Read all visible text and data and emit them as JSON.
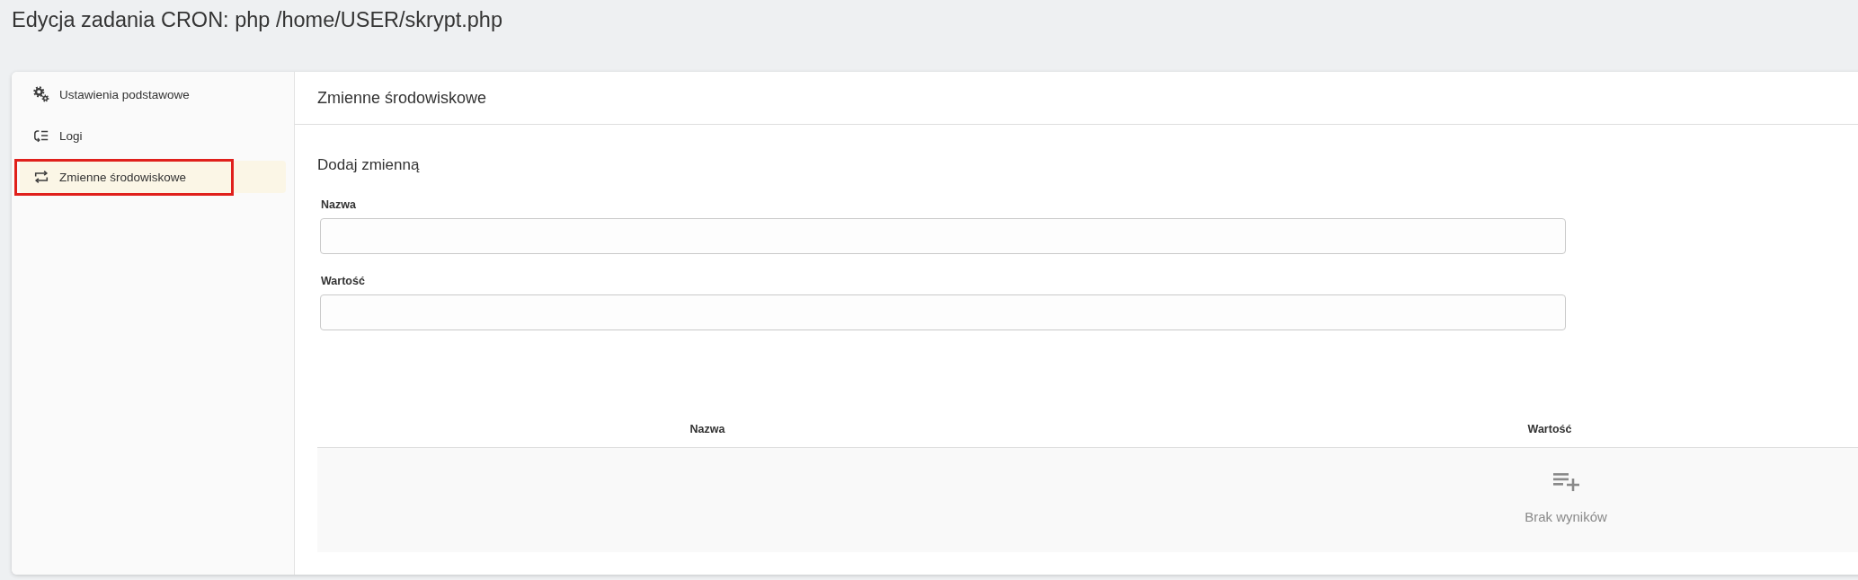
{
  "page": {
    "title": "Edycja zadania CRON: php /home/USER/skrypt.php"
  },
  "sidebar": {
    "items": [
      {
        "kind": "settings",
        "label": "Ustawienia podstawowe",
        "selected": false,
        "highlighted": false
      },
      {
        "kind": "logs",
        "label": "Logi",
        "selected": false,
        "highlighted": false
      },
      {
        "kind": "variables",
        "label": "Zmienne środowiskowe",
        "selected": true,
        "highlighted": true
      }
    ]
  },
  "section": {
    "title": "Zmienne środowiskowe"
  },
  "form": {
    "title": "Dodaj zmienną",
    "fields": [
      {
        "label": "Nazwa"
      },
      {
        "label": "Wartość"
      }
    ]
  },
  "table": {
    "columns": [
      "Nazwa",
      "Wartość"
    ],
    "empty_message": "Brak wyników"
  }
}
